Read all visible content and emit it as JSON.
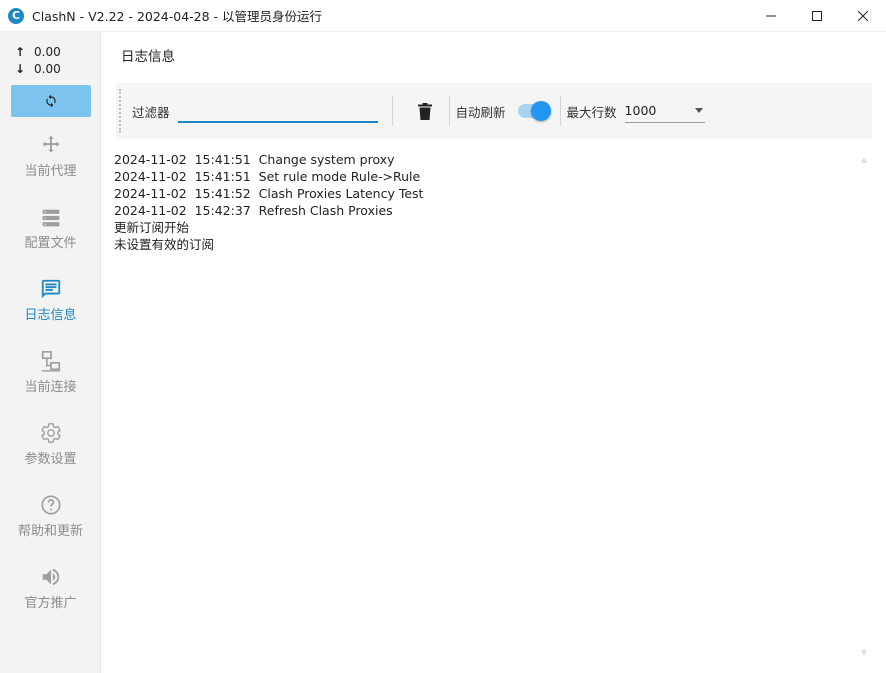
{
  "window": {
    "title": "ClashN - V2.22 - 2024-04-28 - 以管理员身份运行",
    "logo_letter": "C"
  },
  "sidebar": {
    "upload_speed": "0.00",
    "download_speed": "0.00",
    "items": [
      {
        "label": "当前代理",
        "icon": "proxy-icon"
      },
      {
        "label": "配置文件",
        "icon": "profiles-icon"
      },
      {
        "label": "日志信息",
        "icon": "logs-icon",
        "active": true
      },
      {
        "label": "当前连接",
        "icon": "connections-icon"
      },
      {
        "label": "参数设置",
        "icon": "settings-icon"
      },
      {
        "label": "帮助和更新",
        "icon": "help-icon"
      },
      {
        "label": "官方推广",
        "icon": "promotion-icon"
      }
    ]
  },
  "main": {
    "title": "日志信息",
    "toolbar": {
      "filter_label": "过滤器",
      "filter_value": "",
      "auto_refresh_label": "自动刷新",
      "auto_refresh_on": true,
      "max_lines_label": "最大行数",
      "max_lines_value": "1000"
    },
    "logs": [
      "2024-11-02  15:41:51  Change system proxy",
      "2024-11-02  15:41:51  Set rule mode Rule->Rule",
      "2024-11-02  15:41:52  Clash Proxies Latency Test",
      "2024-11-02  15:42:37  Refresh Clash Proxies",
      "更新订阅开始",
      "未设置有效的订阅"
    ]
  },
  "colors": {
    "accent": "#1e88c7",
    "toggle": "#2196f3",
    "sidebar_bg": "#f3f3f3",
    "refresh_button": "#7cc3f0"
  }
}
